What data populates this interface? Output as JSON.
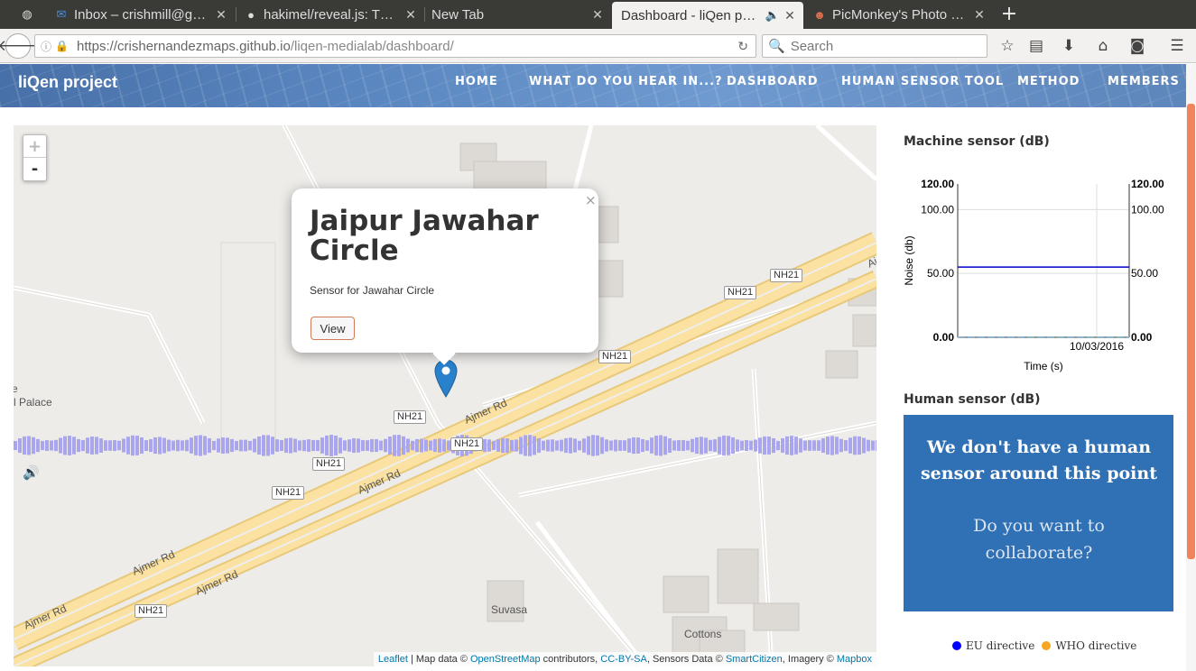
{
  "tabs": [
    {
      "title": "",
      "icon": "globe-icon"
    },
    {
      "title": "Inbox – crishmill@g…",
      "icon": "mail-icon"
    },
    {
      "title": "hakimel/reveal.js: T…",
      "icon": "github-icon"
    },
    {
      "title": "New Tab",
      "icon": ""
    },
    {
      "title": "Dashboard - liQen p…",
      "icon": "speaker-muted-icon"
    },
    {
      "title": "PicMonkey's Photo …",
      "icon": "monkey-icon"
    }
  ],
  "url": {
    "host": "https://crishernandezmaps.github.io",
    "path": "/liqen-medialab/dashboard/"
  },
  "search": {
    "placeholder": "Search"
  },
  "site": {
    "brand": "liQen project",
    "menu": [
      "HOME",
      "WHAT DO YOU HEAR IN...?",
      "DASHBOARD",
      "HUMAN SENSOR TOOL",
      "METHOD",
      "MEMBERS"
    ]
  },
  "map": {
    "zoom_in": "+",
    "zoom_out": "-",
    "popup": {
      "title": "Jaipur Jawahar Circle",
      "desc": "Sensor for Jawahar Circle",
      "button": "View",
      "close": "×"
    },
    "labels": {
      "ajmer1": "Ajmer Rd",
      "ajmer2": "Ajmer Rd",
      "ajmer3": "Ajmer Rd",
      "ajmer4": "Ajmer Rd",
      "ajmer5": "Ajmer Rd",
      "aj": "Aj",
      "palace": "l Palace",
      "e": "e",
      "suvasa": "Suvasa",
      "cottons": "Cottons"
    },
    "shields": [
      "NH21",
      "NH21",
      "NH21",
      "NH21",
      "NH21",
      "NH21",
      "NH21",
      "NH21"
    ],
    "attribution": {
      "leaflet": "Leaflet",
      "t1": " | Map data © ",
      "osm": "OpenStreetMap",
      "t2": " contributors, ",
      "cc": "CC-BY-SA",
      "t3": ", Sensors Data © ",
      "sc": "SmartCitizen",
      "t4": ", Imagery © ",
      "mb": "Mapbox"
    }
  },
  "machine": {
    "title": "Machine sensor (dB)"
  },
  "chart_data": {
    "type": "line",
    "title": "",
    "xlabel": "Time (s)",
    "ylabel": "Noise (db)",
    "ylim": [
      0,
      120
    ],
    "yticks": [
      "0.00",
      "50.00",
      "100.00",
      "120.00"
    ],
    "yticks_right": [
      "0.00",
      "50.00",
      "100.00",
      "120.00"
    ],
    "xticks": [
      "10/03/2016"
    ],
    "series": [
      {
        "name": "EU directive",
        "color": "#0000cc",
        "values": [
          55,
          55
        ]
      },
      {
        "name": "WHO directive",
        "color": "#8fb3c8",
        "values": [
          0,
          0
        ]
      }
    ]
  },
  "human": {
    "title": "Human sensor (dB)",
    "msg": "We don't have a human sensor around this point",
    "ask": "Do you want to collaborate?"
  },
  "legend": [
    {
      "label": "EU directive",
      "color": "#0000ff"
    },
    {
      "label": "WHO directive",
      "color": "#f5a623"
    }
  ]
}
